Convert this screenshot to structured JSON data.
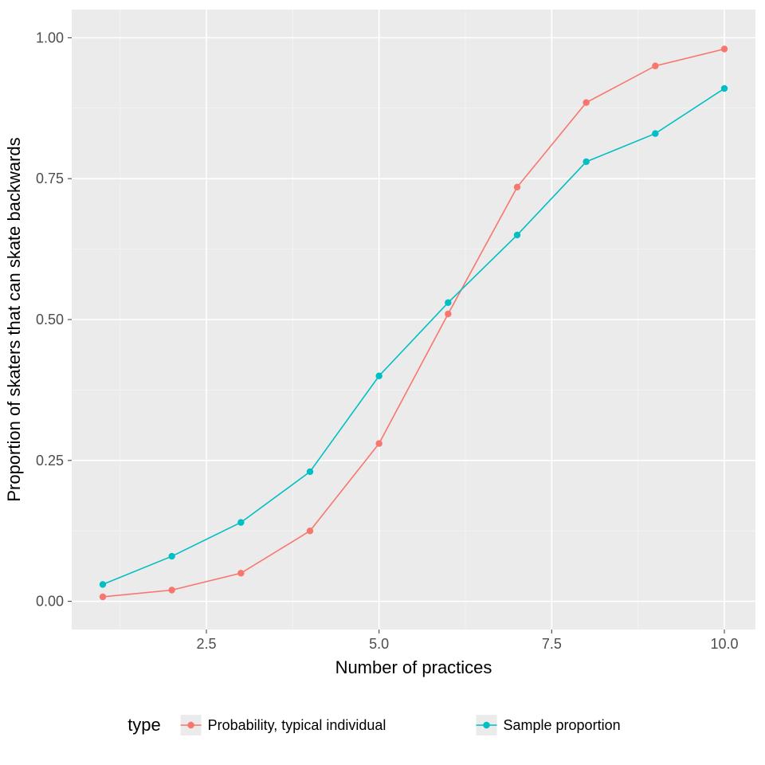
{
  "chart_data": {
    "type": "line",
    "title": "",
    "xlabel": "Number of practices",
    "ylabel": "Proportion of skaters that can skate backwards",
    "legend_title": "type",
    "xlim": [
      1,
      10
    ],
    "ylim": [
      0,
      1
    ],
    "x_ticks": [
      2.5,
      5.0,
      7.5,
      10.0
    ],
    "y_ticks": [
      0.0,
      0.25,
      0.5,
      0.75,
      1.0
    ],
    "x_tick_labels": [
      "2.5",
      "5.0",
      "7.5",
      "10.0"
    ],
    "y_tick_labels": [
      "0.00",
      "0.25",
      "0.50",
      "0.75",
      "1.00"
    ],
    "x": [
      1,
      2,
      3,
      4,
      5,
      6,
      7,
      8,
      9,
      10
    ],
    "series": [
      {
        "name": "Probability, typical individual",
        "color": "#F8766D",
        "values": [
          0.008,
          0.02,
          0.05,
          0.125,
          0.28,
          0.51,
          0.735,
          0.885,
          0.95,
          0.98
        ]
      },
      {
        "name": "Sample proportion",
        "color": "#00BFC4",
        "values": [
          0.03,
          0.08,
          0.14,
          0.23,
          0.4,
          0.53,
          0.65,
          0.78,
          0.83,
          0.91
        ]
      }
    ]
  }
}
